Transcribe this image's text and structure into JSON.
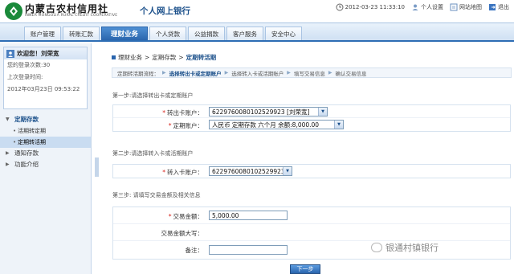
{
  "header": {
    "logo_cn": "内蒙古农村信用社",
    "logo_en": "INNER MONGOLIA RURAL CREDIT COOPERATIVE",
    "system_title": "个人网上银行",
    "datetime": "2012-03-23 11:33:10",
    "links": {
      "settings": "个人设置",
      "sitemap": "网站地图",
      "logout": "退出"
    }
  },
  "nav": {
    "tabs": [
      "账户管理",
      "转账汇款",
      "理财业务",
      "个人贷款",
      "公益捐款",
      "客户服务",
      "安全中心"
    ],
    "active_index": 2
  },
  "sidebar": {
    "welcome": "欢迎您！刘荣宽",
    "login_count": "您的登录次数:30",
    "last_login_label": "上次登录时间:",
    "last_login_time": "2012年03月23日 09:53:22",
    "menu": {
      "group1": "定期存款",
      "item1": "活期转定期",
      "item2": "定期转活期",
      "group2": "通知存款",
      "group3": "功能介绍"
    }
  },
  "main": {
    "breadcrumb": {
      "a": "理财业务",
      "b": "定期存款",
      "c": "定期转活期"
    },
    "flow": {
      "label": "定期转活期流程：",
      "step1": "选择转出卡或定期账户",
      "step2": "选择转入卡或活期账户",
      "step3": "填写交易信息",
      "step4": "确认交易信息"
    },
    "step1_title": "第一步:请选择转出卡或定期账户",
    "step1": {
      "out_card_label": "转出卡账户：",
      "out_card_value": "6229760080102529923 [刘荣宽]",
      "fixed_label": "定期账户：",
      "fixed_value": "人民币 定期存款 六个月 余额:8,000.00"
    },
    "step2_title": "第二步:请选择转入卡或活期账户",
    "step2": {
      "in_card_label": "转入卡账户：",
      "in_card_value": "6229760080102529923"
    },
    "step3_title": "第三步: 请填写交易金额及相关信息",
    "step3": {
      "amount_label": "交易金额：",
      "amount_value": "5,000.00",
      "amount_upper_label": "交易金额大写：",
      "remark_label": "备注："
    },
    "submit_label": "下一步"
  },
  "watermark": "银通村镇银行"
}
